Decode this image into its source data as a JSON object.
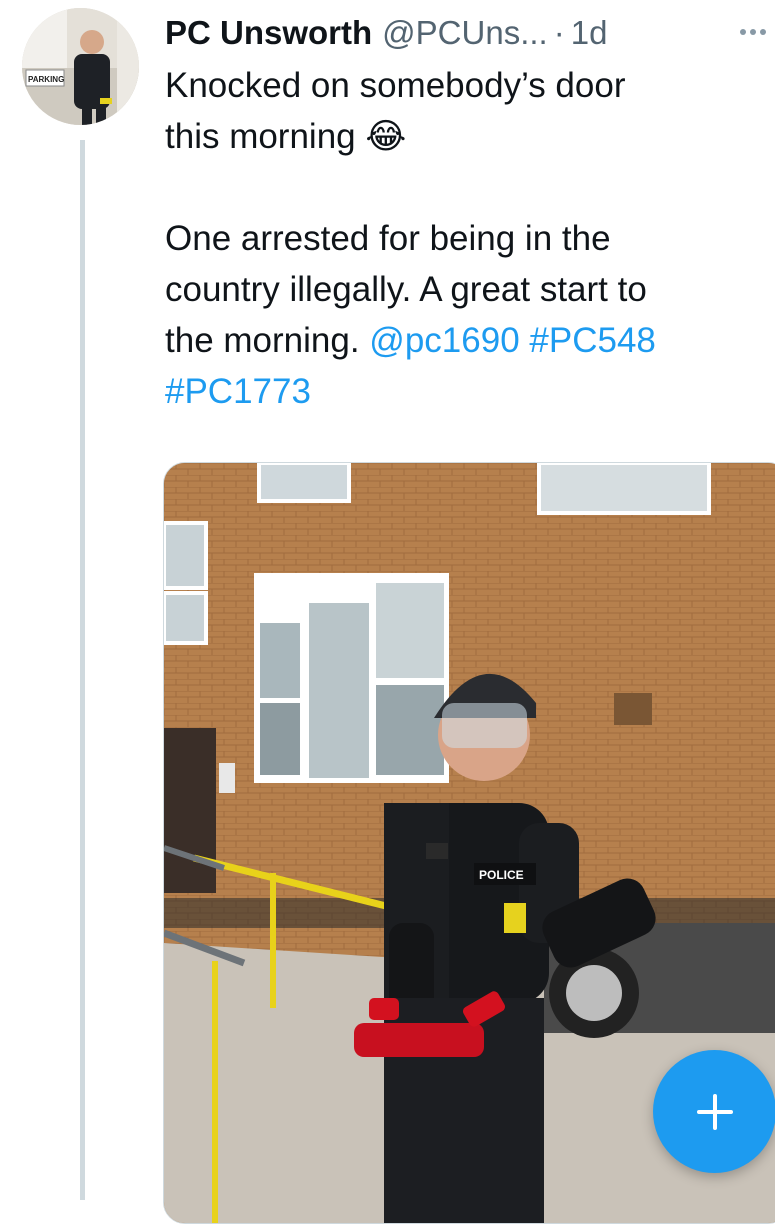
{
  "tweet": {
    "author_name": "PC Unsworth",
    "author_handle": "@PCUns...",
    "separator": "·",
    "timestamp": "1d",
    "text_line1": "Knocked on somebody’s door",
    "text_line2": "this morning 😂",
    "text_line3": "One arrested for being in the",
    "text_line4": "country illegally. A great start to",
    "text_line5_prefix": "the morning.",
    "mention": "@pc1690",
    "hashtag1": "#PC548",
    "hashtag2": "#PC1773"
  },
  "avatar_sign": "PARKING",
  "photo": {
    "vest_label": "POLICE"
  },
  "icons": {
    "more": "more-horizontal-icon",
    "compose": "plus-icon"
  },
  "colors": {
    "link": "#1d9bf0",
    "fab": "#1d9bf0",
    "thread_line": "#cfd9de"
  }
}
